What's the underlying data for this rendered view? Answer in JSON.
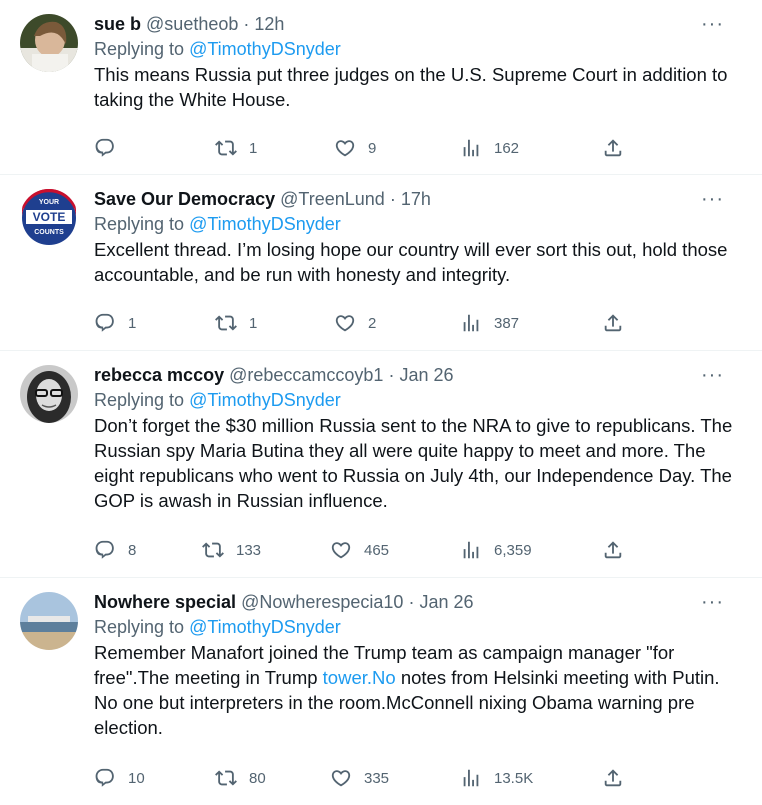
{
  "tweets": [
    {
      "name": "sue b",
      "handle": "@suetheob",
      "time": "12h",
      "reply_prefix": "Replying to",
      "reply_to": "@TimothyDSnyder",
      "text": "This means Russia put three judges on the U.S. Supreme Court in addition to taking the White House.",
      "replies": "",
      "retweets": "1",
      "likes": "9",
      "views": "162"
    },
    {
      "name": "Save Our Democracy",
      "handle": "@TreenLund",
      "time": "17h",
      "reply_prefix": "Replying to",
      "reply_to": "@TimothyDSnyder",
      "text": "Excellent thread. I’m losing hope our country will ever sort this out, hold those accountable, and be run with honesty and integrity.",
      "avatar_text": {
        "top": "YOUR",
        "mid": "VOTE",
        "bottom": "COUNTS"
      },
      "replies": "1",
      "retweets": "1",
      "likes": "2",
      "views": "387"
    },
    {
      "name": "rebecca mccoy",
      "handle": "@rebeccamccoyb1",
      "time": "Jan 26",
      "reply_prefix": "Replying to",
      "reply_to": "@TimothyDSnyder",
      "text": "Don’t forget the $30 million Russia sent to the NRA to give to republicans. The Russian spy Maria Butina they all were quite happy to meet and more. The eight republicans who went to Russia on July 4th, our Independence Day. The GOP is awash in Russian influence.",
      "replies": "8",
      "retweets": "133",
      "likes": "465",
      "views": "6,359"
    },
    {
      "name": "Nowhere special",
      "handle": "@Nowherespecia10",
      "time": "Jan 26",
      "reply_prefix": "Replying to",
      "reply_to": "@TimothyDSnyder",
      "text_before": "Remember Manafort joined the Trump team as campaign manager \"for free\".The meeting in Trump ",
      "text_link": "tower.No",
      "text_after": " notes from Helsinki meeting with Putin. No one but interpreters in the room.McConnell nixing Obama warning pre election.",
      "replies": "10",
      "retweets": "80",
      "likes": "335",
      "views": "13.5K"
    }
  ],
  "dot": "·",
  "more_icon": "···",
  "colors": {
    "link": "#1d9bf0",
    "muted": "#536471",
    "divider": "#eff3f4"
  }
}
